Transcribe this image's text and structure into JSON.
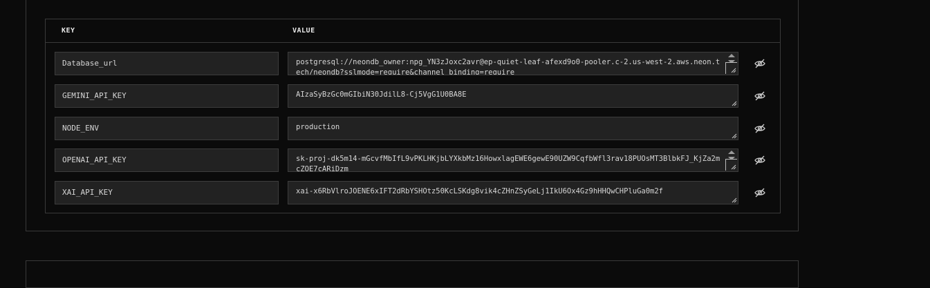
{
  "table": {
    "header": {
      "key_label": "KEY",
      "value_label": "VALUE"
    },
    "rows": [
      {
        "key": "Database_url",
        "value": "postgresql://neondb_owner:npg_YN3zJoxc2avr@ep-quiet-leaf-afexd9o0-pooler.c-2.us-west-2.aws.neon.tech/neondb?sslmode=require&channel_binding=require",
        "reveal_icon": "eye-off-icon"
      },
      {
        "key": "GEMINI_API_KEY",
        "value": "AIzaSyBzGc0mGIbiN30JdilL8-Cj5VgG1U0BA8E",
        "reveal_icon": "eye-off-icon"
      },
      {
        "key": "NODE_ENV",
        "value": "production",
        "reveal_icon": "eye-off-icon"
      },
      {
        "key": "OPENAI_API_KEY",
        "value": "sk-proj-dk5m14-mGcvfMbIfL9vPKLHKjbLYXkbMz16HowxlagEWE6gewE90UZW9CqfbWfl3rav18PUOsMT3BlbkFJ_KjZa2mcZOE7cARiDzm",
        "reveal_icon": "eye-off-icon"
      },
      {
        "key": "XAI_API_KEY",
        "value": "xai-x6RbVlroJOENE6xIFT2dRbYSHOtz50KcLSKdg8vik4cZHnZSyGeLj1IkU6Ox4Gz9hHHQwCHPluGa0m2f",
        "reveal_icon": "eye-off-icon"
      }
    ]
  },
  "colors": {
    "background": "#0b0b0b",
    "field_background": "#222222",
    "border": "#3a3a3a",
    "text": "#d8d8d8"
  }
}
